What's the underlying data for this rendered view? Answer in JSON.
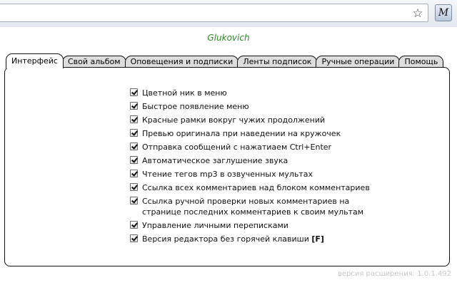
{
  "browser": {
    "star_icon": "star-icon",
    "extension_letter": "M"
  },
  "popup": {
    "brand": "Glukovich",
    "tabs": [
      {
        "label": "Интерфейс",
        "active": true
      },
      {
        "label": "Свой альбом",
        "active": false
      },
      {
        "label": "Оповещения и подписки",
        "active": false
      },
      {
        "label": "Ленты подписок",
        "active": false
      },
      {
        "label": "Ручные операции",
        "active": false
      },
      {
        "label": "Помощь",
        "active": false
      }
    ],
    "options": [
      {
        "label": "Цветной ник в меню",
        "checked": true
      },
      {
        "label": "Быстрое появление меню",
        "checked": true
      },
      {
        "label": "Красные рамки вокруг чужих продолжений",
        "checked": true
      },
      {
        "label": "Превью оригинала при наведении на кружочек",
        "checked": true
      },
      {
        "label": "Отправка сообщений с нажатиаем Ctrl+Enter",
        "checked": true
      },
      {
        "label": "Автоматическое заглушение звука",
        "checked": true
      },
      {
        "label": "Чтение тегов mp3 в озвученных мультах",
        "checked": true
      },
      {
        "label": "Ссылка всех комментариев над блоком комментариев",
        "checked": true
      },
      {
        "label": "Ссылка ручной проверки новых комментариев на странице последних комментариев к своим мультам",
        "checked": true
      },
      {
        "label": "Управление личными переписками",
        "checked": true
      },
      {
        "label": "Версия редактора без горячей клавиши",
        "hotkey": "[F]",
        "checked": true
      }
    ],
    "version": "версия расширения: 1.0.1.492"
  }
}
